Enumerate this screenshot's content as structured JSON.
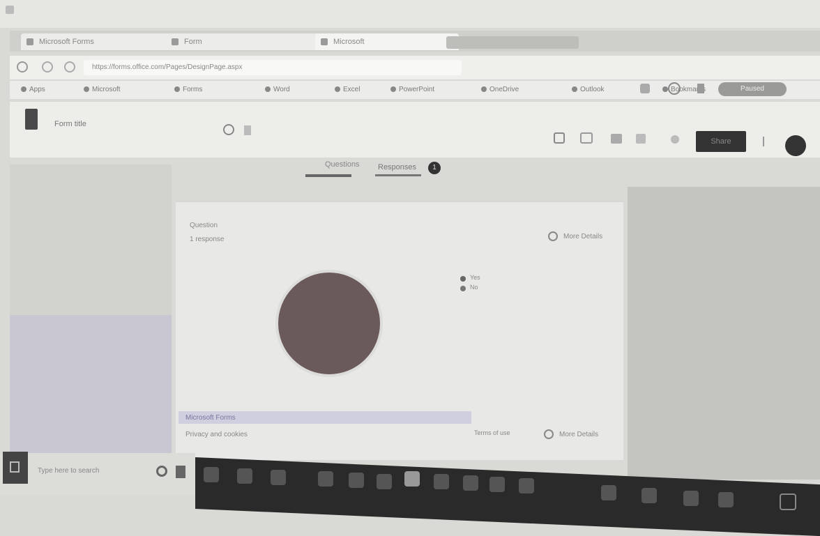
{
  "browser": {
    "tabs": [
      {
        "label": "Microsoft Forms"
      },
      {
        "label": "Form"
      },
      {
        "label": "Microsoft"
      }
    ],
    "address": "https://forms.office.com/Pages/DesignPage.aspx",
    "bookmarks": [
      {
        "label": "Apps"
      },
      {
        "label": "Microsoft"
      },
      {
        "label": "Forms"
      },
      {
        "label": "Word"
      },
      {
        "label": "Excel"
      },
      {
        "label": "PowerPoint"
      },
      {
        "label": "OneDrive"
      },
      {
        "label": "Outlook"
      },
      {
        "label": "Bookmarks"
      }
    ],
    "profile_label": "Paused"
  },
  "app": {
    "form_title": "Form title",
    "share_label": "Share",
    "tabs": [
      {
        "label": "Questions"
      },
      {
        "label": "Responses"
      }
    ],
    "response_count": "1"
  },
  "question": {
    "title": "Question",
    "sub": "1 response",
    "more_details": "More Details",
    "legend": [
      {
        "label": "Yes",
        "color": "#666666"
      },
      {
        "label": "No",
        "color": "#777777"
      }
    ],
    "pie_color": "#6a5a5a"
  },
  "footer": {
    "link_text": "Microsoft Forms",
    "sub_text": "Privacy and cookies",
    "right_text": "Terms of use",
    "more_details": "More Details"
  },
  "taskbar": {
    "search_placeholder": "Type here to search"
  }
}
